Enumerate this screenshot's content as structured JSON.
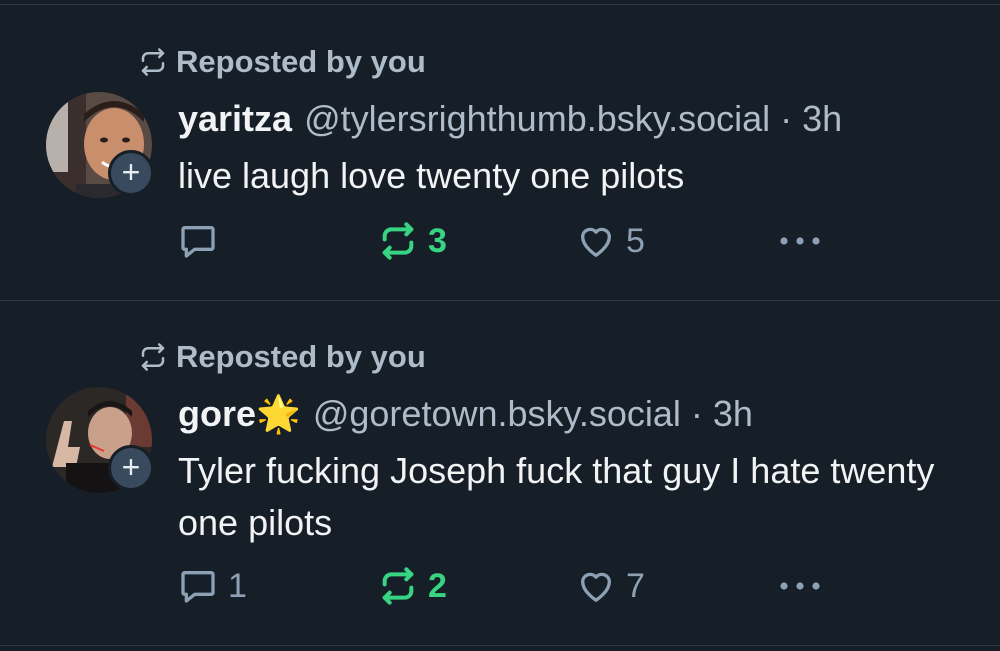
{
  "colors": {
    "background": "#161e27",
    "muted": "#aebbc9",
    "repost_active": "#37d583",
    "text": "#f1f3f5"
  },
  "posts": [
    {
      "repost_label": "Reposted by you",
      "display_name": "yaritza",
      "handle": "@tylersrighthumb.bsky.social",
      "separator": "·",
      "time": "3h",
      "text": "live laugh love twenty one pilots",
      "follow_badge": "+",
      "reply_count": "",
      "repost_count": "3",
      "like_count": "5",
      "icons": [
        "repost-icon",
        "avatar",
        "reply-icon",
        "repost-icon",
        "heart-icon",
        "more-icon"
      ]
    },
    {
      "repost_label": "Reposted by you",
      "display_name": "gore🌟",
      "handle": "@goretown.bsky.social",
      "separator": "·",
      "time": "3h",
      "text": "Tyler fucking Joseph fuck that guy I hate twenty one pilots",
      "follow_badge": "+",
      "reply_count": "1",
      "repost_count": "2",
      "like_count": "7",
      "icons": [
        "repost-icon",
        "avatar",
        "reply-icon",
        "repost-icon",
        "heart-icon",
        "more-icon"
      ]
    }
  ]
}
